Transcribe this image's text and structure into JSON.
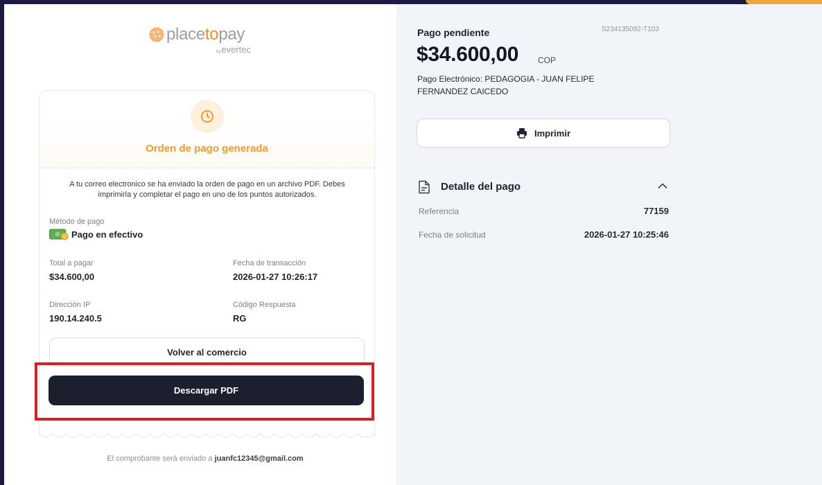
{
  "brand": {
    "name_part1": "place",
    "name_part2": "to",
    "name_part3": "pay",
    "by": "by",
    "sub": "evertec",
    "accent_color": "#ef9a35"
  },
  "order": {
    "status_icon": "clock-icon",
    "title": "Orden de pago generada",
    "notice": "A tu correo electronico se ha enviado la orden de pago en un archivo PDF. Debes imprimirla y completar el pago en uno de los puntos autorizados.",
    "method_label": "Método de pago",
    "method_icon": "cash-icon",
    "method_value": "Pago en efectivo",
    "total_label": "Total a pagar",
    "total_value": "$34.600,00",
    "date_label": "Fecha de transacción",
    "date_value": "2026-01-27 10:26:17",
    "ip_label": "Dirección IP",
    "ip_value": "190.14.240.5",
    "code_label": "Código Respuesta",
    "code_value": "RG",
    "back_button": "Volver al comercio",
    "download_button": "Descargar PDF",
    "footer_prefix": "El comprobante será enviado a",
    "footer_email": "juanfc12345@gmail.com"
  },
  "summary": {
    "status": "Pago pendiente",
    "code": "S234135092-T103",
    "amount": "$34.600,00",
    "currency": "COP",
    "description": "Pago Electrónico: PEDAGOGIA - JUAN FELIPE FERNANDEZ CAICEDO",
    "print_button": "Imprimir",
    "print_icon": "printer-icon",
    "detail_title": "Detalle del pago",
    "detail_icon": "document-icon",
    "rows": [
      {
        "label": "Referencia",
        "value": "77159"
      },
      {
        "label": "Fecha de solicitud",
        "value": "2026-01-27 10:25:46"
      }
    ]
  },
  "colors": {
    "dark_button": "#1c1f2e",
    "highlight_border": "#d81f26",
    "frame": "#1f1d4a"
  }
}
